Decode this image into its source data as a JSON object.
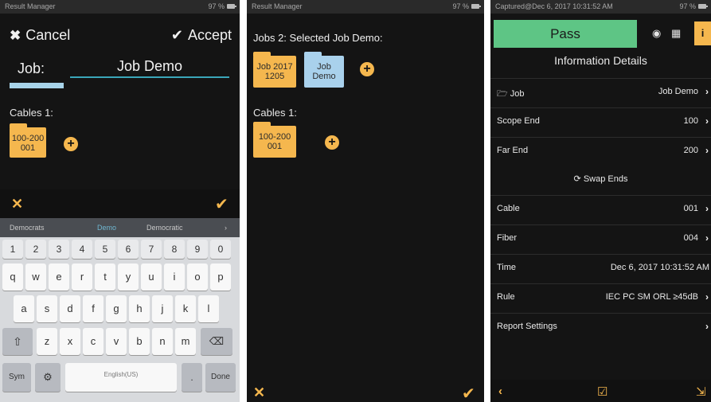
{
  "screen1": {
    "status_title": "Result Manager",
    "battery": "97 %",
    "cancel_label": "Cancel",
    "accept_label": "Accept",
    "job_label": "Job:",
    "job_value": "Job Demo",
    "cables_label": "Cables 1:",
    "cable_folder": "100-200\n001",
    "keyboard": {
      "suggestions": [
        "Democrats",
        "Demo",
        "Democratic"
      ],
      "number_row": [
        "1",
        "2",
        "3",
        "4",
        "5",
        "6",
        "7",
        "8",
        "9",
        "0"
      ],
      "row1": [
        "q",
        "w",
        "e",
        "r",
        "t",
        "y",
        "u",
        "i",
        "o",
        "p"
      ],
      "row2": [
        "a",
        "s",
        "d",
        "f",
        "g",
        "h",
        "j",
        "k",
        "l"
      ],
      "row3": [
        "z",
        "x",
        "c",
        "v",
        "b",
        "n",
        "m"
      ],
      "sym_label": "Sym",
      "space_label": "English(US)",
      "done_label": "Done"
    }
  },
  "screen2": {
    "status_title": "Result Manager",
    "battery": "97 %",
    "jobs_label": "Jobs 2: Selected Job Demo:",
    "job_folder_1": "Job 2017\n1205",
    "job_folder_2": "Job\nDemo",
    "cables_label": "Cables 1:",
    "cable_folder": "100-200\n001"
  },
  "screen3": {
    "status_title": "Captured@Dec 6, 2017 10:31:52 AM",
    "battery": "97 %",
    "pass_label": "Pass",
    "info_icon_label": "i",
    "heading": "Information Details",
    "rows": [
      {
        "label": "Job",
        "value": "Job Demo"
      },
      {
        "label": "Scope End",
        "value": "100"
      },
      {
        "label": "Far End",
        "value": "200"
      },
      {
        "label": "Cable",
        "value": "001"
      },
      {
        "label": "Fiber",
        "value": "004"
      },
      {
        "label": "Time",
        "value": "Dec 6, 2017 10:31:52 AM"
      },
      {
        "label": "Rule",
        "value": "IEC PC SM ORL ≥45dB"
      },
      {
        "label": "Report Settings",
        "value": ""
      }
    ],
    "swap_label": "Swap Ends"
  },
  "colors": {
    "accent": "#f5b74e",
    "pass_green": "#5ec585",
    "input_underline": "#3aa6b9",
    "folder_blue": "#a9d1ec",
    "background": "#141414"
  }
}
